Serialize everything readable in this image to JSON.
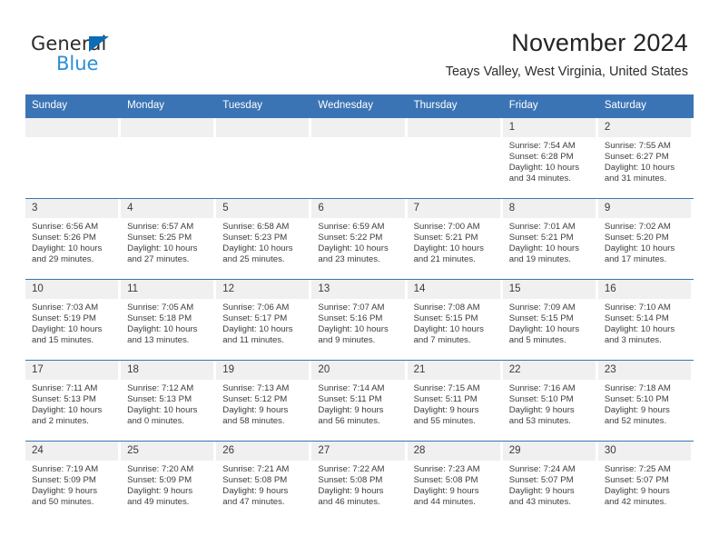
{
  "brand": {
    "word_general": "General",
    "word_blue": "Blue",
    "triangle_color": "#0d6cb5",
    "blue_color": "#2b8fd4"
  },
  "header": {
    "month_title": "November 2024",
    "location": "Teays Valley, West Virginia, United States",
    "accent_color": "#3b74b5",
    "daynum_band_color": "#f0f0f0"
  },
  "weekday_headers": [
    "Sunday",
    "Monday",
    "Tuesday",
    "Wednesday",
    "Thursday",
    "Friday",
    "Saturday"
  ],
  "labels": {
    "sunrise": "Sunrise:",
    "sunset": "Sunset:",
    "daylight": "Daylight:"
  },
  "weeks": [
    [
      {
        "day": "",
        "sunrise": "",
        "sunset": "",
        "daylight_line1": "",
        "daylight_line2": ""
      },
      {
        "day": "",
        "sunrise": "",
        "sunset": "",
        "daylight_line1": "",
        "daylight_line2": ""
      },
      {
        "day": "",
        "sunrise": "",
        "sunset": "",
        "daylight_line1": "",
        "daylight_line2": ""
      },
      {
        "day": "",
        "sunrise": "",
        "sunset": "",
        "daylight_line1": "",
        "daylight_line2": ""
      },
      {
        "day": "",
        "sunrise": "",
        "sunset": "",
        "daylight_line1": "",
        "daylight_line2": ""
      },
      {
        "day": "1",
        "sunrise": "Sunrise: 7:54 AM",
        "sunset": "Sunset: 6:28 PM",
        "daylight_line1": "Daylight: 10 hours",
        "daylight_line2": "and 34 minutes."
      },
      {
        "day": "2",
        "sunrise": "Sunrise: 7:55 AM",
        "sunset": "Sunset: 6:27 PM",
        "daylight_line1": "Daylight: 10 hours",
        "daylight_line2": "and 31 minutes."
      }
    ],
    [
      {
        "day": "3",
        "sunrise": "Sunrise: 6:56 AM",
        "sunset": "Sunset: 5:26 PM",
        "daylight_line1": "Daylight: 10 hours",
        "daylight_line2": "and 29 minutes."
      },
      {
        "day": "4",
        "sunrise": "Sunrise: 6:57 AM",
        "sunset": "Sunset: 5:25 PM",
        "daylight_line1": "Daylight: 10 hours",
        "daylight_line2": "and 27 minutes."
      },
      {
        "day": "5",
        "sunrise": "Sunrise: 6:58 AM",
        "sunset": "Sunset: 5:23 PM",
        "daylight_line1": "Daylight: 10 hours",
        "daylight_line2": "and 25 minutes."
      },
      {
        "day": "6",
        "sunrise": "Sunrise: 6:59 AM",
        "sunset": "Sunset: 5:22 PM",
        "daylight_line1": "Daylight: 10 hours",
        "daylight_line2": "and 23 minutes."
      },
      {
        "day": "7",
        "sunrise": "Sunrise: 7:00 AM",
        "sunset": "Sunset: 5:21 PM",
        "daylight_line1": "Daylight: 10 hours",
        "daylight_line2": "and 21 minutes."
      },
      {
        "day": "8",
        "sunrise": "Sunrise: 7:01 AM",
        "sunset": "Sunset: 5:21 PM",
        "daylight_line1": "Daylight: 10 hours",
        "daylight_line2": "and 19 minutes."
      },
      {
        "day": "9",
        "sunrise": "Sunrise: 7:02 AM",
        "sunset": "Sunset: 5:20 PM",
        "daylight_line1": "Daylight: 10 hours",
        "daylight_line2": "and 17 minutes."
      }
    ],
    [
      {
        "day": "10",
        "sunrise": "Sunrise: 7:03 AM",
        "sunset": "Sunset: 5:19 PM",
        "daylight_line1": "Daylight: 10 hours",
        "daylight_line2": "and 15 minutes."
      },
      {
        "day": "11",
        "sunrise": "Sunrise: 7:05 AM",
        "sunset": "Sunset: 5:18 PM",
        "daylight_line1": "Daylight: 10 hours",
        "daylight_line2": "and 13 minutes."
      },
      {
        "day": "12",
        "sunrise": "Sunrise: 7:06 AM",
        "sunset": "Sunset: 5:17 PM",
        "daylight_line1": "Daylight: 10 hours",
        "daylight_line2": "and 11 minutes."
      },
      {
        "day": "13",
        "sunrise": "Sunrise: 7:07 AM",
        "sunset": "Sunset: 5:16 PM",
        "daylight_line1": "Daylight: 10 hours",
        "daylight_line2": "and 9 minutes."
      },
      {
        "day": "14",
        "sunrise": "Sunrise: 7:08 AM",
        "sunset": "Sunset: 5:15 PM",
        "daylight_line1": "Daylight: 10 hours",
        "daylight_line2": "and 7 minutes."
      },
      {
        "day": "15",
        "sunrise": "Sunrise: 7:09 AM",
        "sunset": "Sunset: 5:15 PM",
        "daylight_line1": "Daylight: 10 hours",
        "daylight_line2": "and 5 minutes."
      },
      {
        "day": "16",
        "sunrise": "Sunrise: 7:10 AM",
        "sunset": "Sunset: 5:14 PM",
        "daylight_line1": "Daylight: 10 hours",
        "daylight_line2": "and 3 minutes."
      }
    ],
    [
      {
        "day": "17",
        "sunrise": "Sunrise: 7:11 AM",
        "sunset": "Sunset: 5:13 PM",
        "daylight_line1": "Daylight: 10 hours",
        "daylight_line2": "and 2 minutes."
      },
      {
        "day": "18",
        "sunrise": "Sunrise: 7:12 AM",
        "sunset": "Sunset: 5:13 PM",
        "daylight_line1": "Daylight: 10 hours",
        "daylight_line2": "and 0 minutes."
      },
      {
        "day": "19",
        "sunrise": "Sunrise: 7:13 AM",
        "sunset": "Sunset: 5:12 PM",
        "daylight_line1": "Daylight: 9 hours",
        "daylight_line2": "and 58 minutes."
      },
      {
        "day": "20",
        "sunrise": "Sunrise: 7:14 AM",
        "sunset": "Sunset: 5:11 PM",
        "daylight_line1": "Daylight: 9 hours",
        "daylight_line2": "and 56 minutes."
      },
      {
        "day": "21",
        "sunrise": "Sunrise: 7:15 AM",
        "sunset": "Sunset: 5:11 PM",
        "daylight_line1": "Daylight: 9 hours",
        "daylight_line2": "and 55 minutes."
      },
      {
        "day": "22",
        "sunrise": "Sunrise: 7:16 AM",
        "sunset": "Sunset: 5:10 PM",
        "daylight_line1": "Daylight: 9 hours",
        "daylight_line2": "and 53 minutes."
      },
      {
        "day": "23",
        "sunrise": "Sunrise: 7:18 AM",
        "sunset": "Sunset: 5:10 PM",
        "daylight_line1": "Daylight: 9 hours",
        "daylight_line2": "and 52 minutes."
      }
    ],
    [
      {
        "day": "24",
        "sunrise": "Sunrise: 7:19 AM",
        "sunset": "Sunset: 5:09 PM",
        "daylight_line1": "Daylight: 9 hours",
        "daylight_line2": "and 50 minutes."
      },
      {
        "day": "25",
        "sunrise": "Sunrise: 7:20 AM",
        "sunset": "Sunset: 5:09 PM",
        "daylight_line1": "Daylight: 9 hours",
        "daylight_line2": "and 49 minutes."
      },
      {
        "day": "26",
        "sunrise": "Sunrise: 7:21 AM",
        "sunset": "Sunset: 5:08 PM",
        "daylight_line1": "Daylight: 9 hours",
        "daylight_line2": "and 47 minutes."
      },
      {
        "day": "27",
        "sunrise": "Sunrise: 7:22 AM",
        "sunset": "Sunset: 5:08 PM",
        "daylight_line1": "Daylight: 9 hours",
        "daylight_line2": "and 46 minutes."
      },
      {
        "day": "28",
        "sunrise": "Sunrise: 7:23 AM",
        "sunset": "Sunset: 5:08 PM",
        "daylight_line1": "Daylight: 9 hours",
        "daylight_line2": "and 44 minutes."
      },
      {
        "day": "29",
        "sunrise": "Sunrise: 7:24 AM",
        "sunset": "Sunset: 5:07 PM",
        "daylight_line1": "Daylight: 9 hours",
        "daylight_line2": "and 43 minutes."
      },
      {
        "day": "30",
        "sunrise": "Sunrise: 7:25 AM",
        "sunset": "Sunset: 5:07 PM",
        "daylight_line1": "Daylight: 9 hours",
        "daylight_line2": "and 42 minutes."
      }
    ]
  ]
}
